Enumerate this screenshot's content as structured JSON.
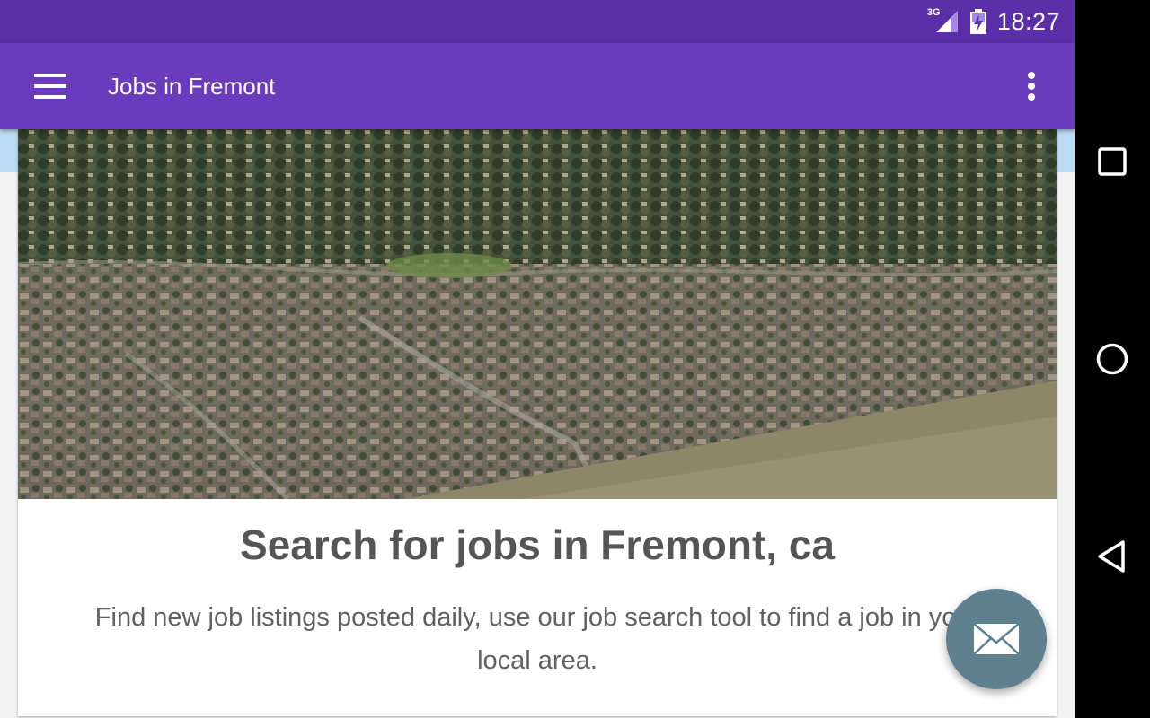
{
  "status_bar": {
    "network_label": "3G",
    "time": "18:27"
  },
  "app_bar": {
    "title": "Jobs in Fremont",
    "menu_icon": "hamburger-menu-icon",
    "overflow_icon": "more-vert-icon"
  },
  "card": {
    "image_alt": "Aerial view of Fremont neighborhood",
    "title": "Search for jobs in Fremont, ca",
    "body": "Find new job listings posted daily, use our job search tool to find a job in your local area."
  },
  "fab": {
    "icon": "envelope-icon"
  },
  "nav_bar": {
    "icons": [
      "recents-square-icon",
      "home-circle-icon",
      "back-triangle-icon"
    ]
  },
  "colors": {
    "status_bar": "#5a2fa8",
    "app_bar": "#6a3bbd",
    "fab": "#5f808e",
    "strip": "#bcdcf5"
  }
}
